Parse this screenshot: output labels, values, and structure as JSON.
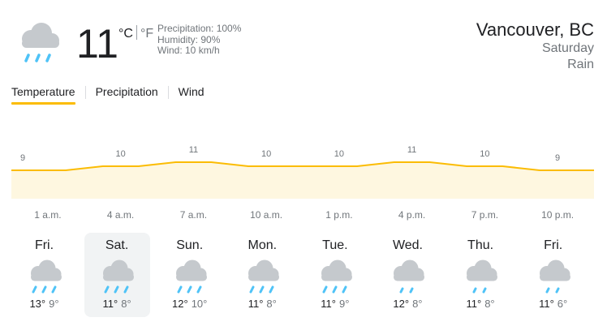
{
  "current": {
    "icon": "rain-icon",
    "temperature": "11",
    "unit_c": "°C",
    "unit_f": "°F",
    "precipitation": "Precipitation: 100%",
    "humidity": "Humidity: 90%",
    "wind": "Wind: 10 km/h"
  },
  "location": {
    "name": "Vancouver, BC",
    "day": "Saturday",
    "condition": "Rain"
  },
  "tabs": [
    {
      "label": "Temperature",
      "active": true
    },
    {
      "label": "Precipitation",
      "active": false
    },
    {
      "label": "Wind",
      "active": false
    }
  ],
  "chart_data": {
    "type": "area",
    "x": [
      "1 a.m.",
      "4 a.m.",
      "7 a.m.",
      "10 a.m.",
      "1 p.m.",
      "4 p.m.",
      "7 p.m.",
      "10 p.m."
    ],
    "values": [
      9,
      10,
      11,
      10,
      10,
      11,
      10,
      9
    ],
    "labels": [
      "9",
      "10",
      "11",
      "10",
      "10",
      "11",
      "10",
      "9"
    ],
    "line_color": "#fbbc04",
    "fill_color": "#fef7e0"
  },
  "days": [
    {
      "name": "Fri.",
      "icon": "rain-icon",
      "high": "13°",
      "low": "9°",
      "selected": false
    },
    {
      "name": "Sat.",
      "icon": "rain-icon",
      "high": "11°",
      "low": "8°",
      "selected": true
    },
    {
      "name": "Sun.",
      "icon": "rain-icon",
      "high": "12°",
      "low": "10°",
      "selected": false
    },
    {
      "name": "Mon.",
      "icon": "rain-icon",
      "high": "11°",
      "low": "8°",
      "selected": false
    },
    {
      "name": "Tue.",
      "icon": "rain-icon",
      "high": "11°",
      "low": "9°",
      "selected": false
    },
    {
      "name": "Wed.",
      "icon": "showers-icon",
      "high": "12°",
      "low": "8°",
      "selected": false
    },
    {
      "name": "Thu.",
      "icon": "showers-icon",
      "high": "11°",
      "low": "8°",
      "selected": false
    },
    {
      "name": "Fri.",
      "icon": "showers-icon",
      "high": "11°",
      "low": "6°",
      "selected": false
    }
  ]
}
